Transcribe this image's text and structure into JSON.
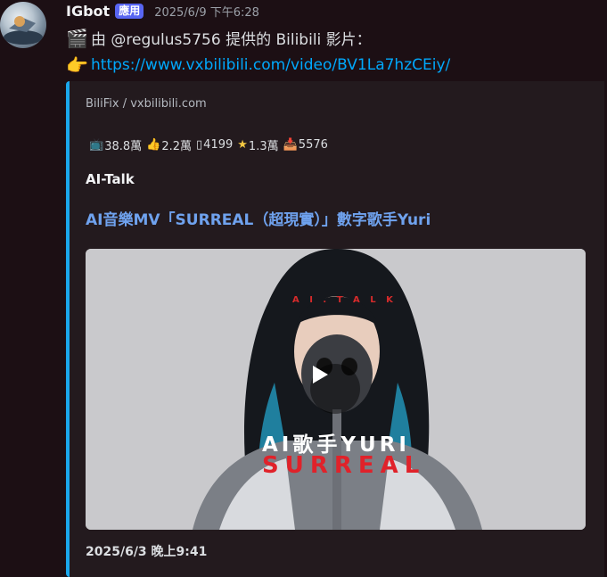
{
  "message": {
    "username": "IGbot",
    "app_badge": "應用",
    "timestamp": "2025/6/9 下午6:28",
    "line1": {
      "emoji": "🎬",
      "text": "由 @regulus5756 提供的 Bilibili 影片："
    },
    "line2": {
      "emoji": "👉",
      "link": "https://www.vxbilibili.com/video/BV1La7hzCEiy/"
    }
  },
  "embed": {
    "accent_color": "#1aa7ec",
    "provider": "BiliFix / vxbilibili.com",
    "stats": [
      {
        "icon": "📺",
        "value": "38.8萬"
      },
      {
        "icon": "👍",
        "value": "2.2萬"
      },
      {
        "icon": "▯",
        "value": "4199"
      },
      {
        "icon": "★",
        "value": "1.3萬"
      },
      {
        "icon": "📥",
        "value": "5576"
      }
    ],
    "author": "AI-Talk",
    "title": "AI音樂MV「SURREAL（超現實）」數字歌手Yuri",
    "thumbnail": {
      "watermark": "A I . T A L K",
      "overlay_line1": "AI歌手YURI",
      "overlay_line2": "SURREAL"
    },
    "footer": "2025/6/3 晚上9:41"
  }
}
